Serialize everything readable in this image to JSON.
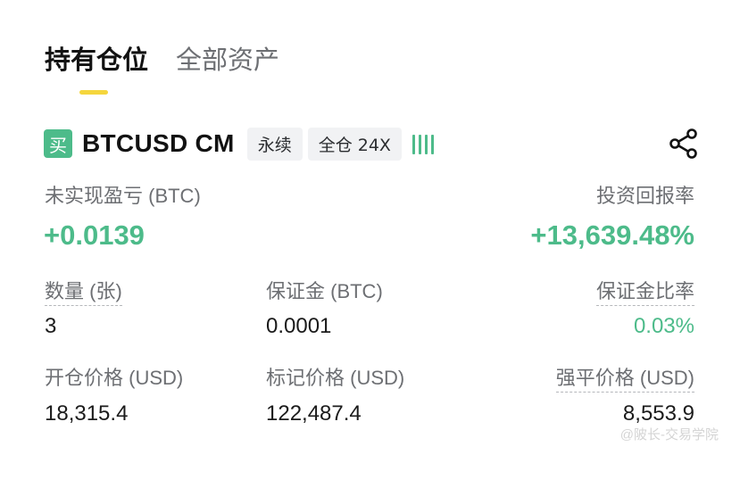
{
  "colors": {
    "accent_yellow": "#f5d63d",
    "profit_green": "#4dbb8a",
    "text_primary": "#121212",
    "text_secondary": "#6d6f73"
  },
  "tabs": [
    {
      "label": "持有仓位",
      "active": true
    },
    {
      "label": "全部资产",
      "active": false
    }
  ],
  "position": {
    "side_label": "买",
    "symbol": "BTCUSD CM",
    "tags": [
      "永续",
      "全仓 24X"
    ],
    "signal_icon": "signal-bars-icon",
    "share_icon": "share-icon"
  },
  "pnl": {
    "label": "未实现盈亏 (BTC)",
    "value": "+0.0139",
    "roi_label": "投资回报率",
    "roi_value": "+13,639.48%"
  },
  "details": {
    "quantity_label": "数量 (张)",
    "quantity_value": "3",
    "margin_label": "保证金 (BTC)",
    "margin_value": "0.0001",
    "margin_ratio_label": "保证金比率",
    "margin_ratio_value": "0.03%",
    "entry_price_label": "开仓价格 (USD)",
    "entry_price_value": "18,315.4",
    "mark_price_label": "标记价格 (USD)",
    "mark_price_value": "122,487.4",
    "liq_price_label": "强平价格 (USD)",
    "liq_price_value": "8,553.9"
  },
  "watermark": "@陂长-交易学院"
}
